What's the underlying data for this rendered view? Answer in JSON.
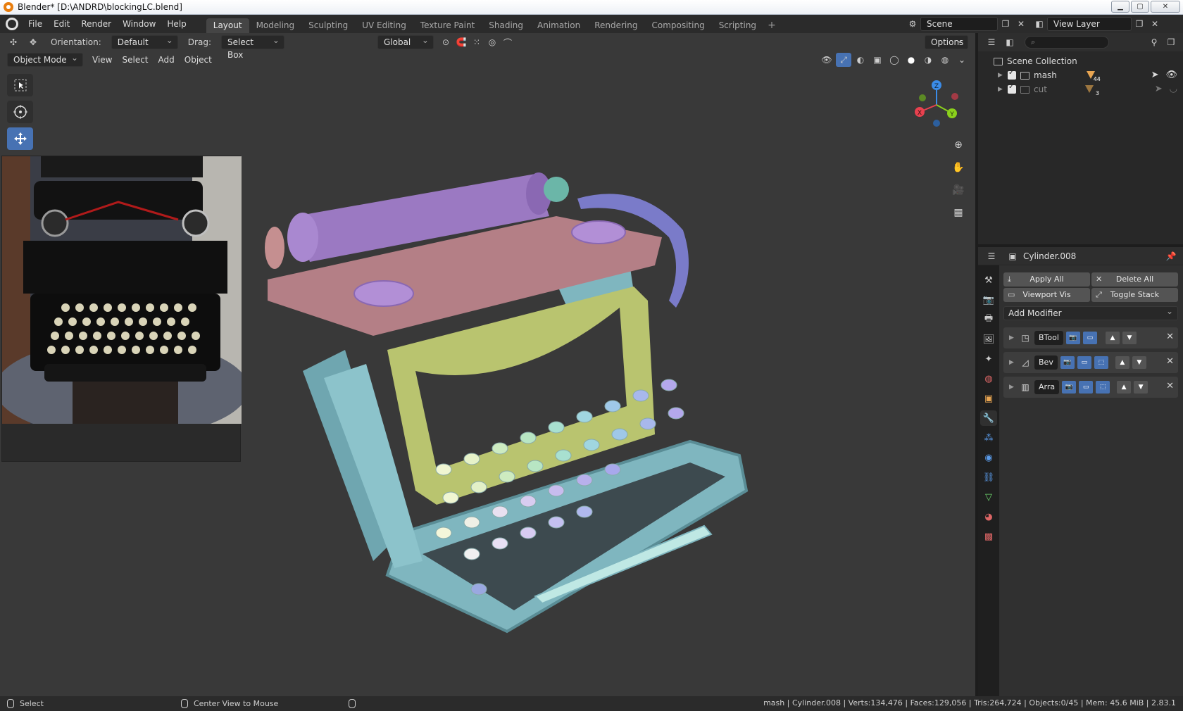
{
  "window": {
    "title": "Blender* [D:\\ANDRD\\blockingLC.blend]",
    "buttons": [
      "minimize",
      "maximize",
      "close"
    ]
  },
  "menubar": {
    "items": [
      "File",
      "Edit",
      "Render",
      "Window",
      "Help"
    ]
  },
  "workspaces": {
    "tabs": [
      "Layout",
      "Modeling",
      "Sculpting",
      "UV Editing",
      "Texture Paint",
      "Shading",
      "Animation",
      "Rendering",
      "Compositing",
      "Scripting"
    ],
    "active": "Layout",
    "add": "+"
  },
  "scene": {
    "name": "Scene"
  },
  "view_layer": {
    "name": "View Layer"
  },
  "viewport_header": {
    "orientation_label": "Orientation:",
    "orientation_value": "Default",
    "drag_label": "Drag:",
    "drag_value": "Select Box",
    "transform_orientation": "Global",
    "options": "Options",
    "mode": "Object Mode",
    "menus": [
      "View",
      "Select",
      "Add",
      "Object"
    ]
  },
  "gizmo": {
    "x": "X",
    "y": "Y",
    "z": "Z"
  },
  "colors": {
    "accent": "#4772b3",
    "frame": "#7fb6bf",
    "keys": "#b9c46f",
    "carriage_base": "#b47f86",
    "platen": "#9b79c2",
    "handle": "#7a7bc9",
    "x_axis": "#e8414f",
    "y_axis": "#8bd11c",
    "z_axis": "#3b8ce8"
  },
  "outliner": {
    "root": "Scene Collection",
    "rows": [
      {
        "name": "mash",
        "badge": "44"
      },
      {
        "name": "cut",
        "badge": "3"
      }
    ],
    "search_placeholder": ""
  },
  "properties": {
    "object_name": "Cylinder.008",
    "buttons": {
      "apply_all": "Apply All",
      "delete_all": "Delete All",
      "viewport_vis": "Viewport Vis",
      "toggle_stack": "Toggle Stack"
    },
    "add_modifier": "Add Modifier",
    "modifiers": [
      {
        "name": "BTool"
      },
      {
        "name": "Bev"
      },
      {
        "name": "Arra"
      }
    ]
  },
  "statusbar": {
    "left_action": "Select",
    "middle_action": "Center View to Mouse",
    "stats": "mash | Cylinder.008 | Verts:134,476 | Faces:129,056 | Tris:264,724 | Objects:0/45 | Mem: 45.6 MiB | 2.83.1"
  }
}
